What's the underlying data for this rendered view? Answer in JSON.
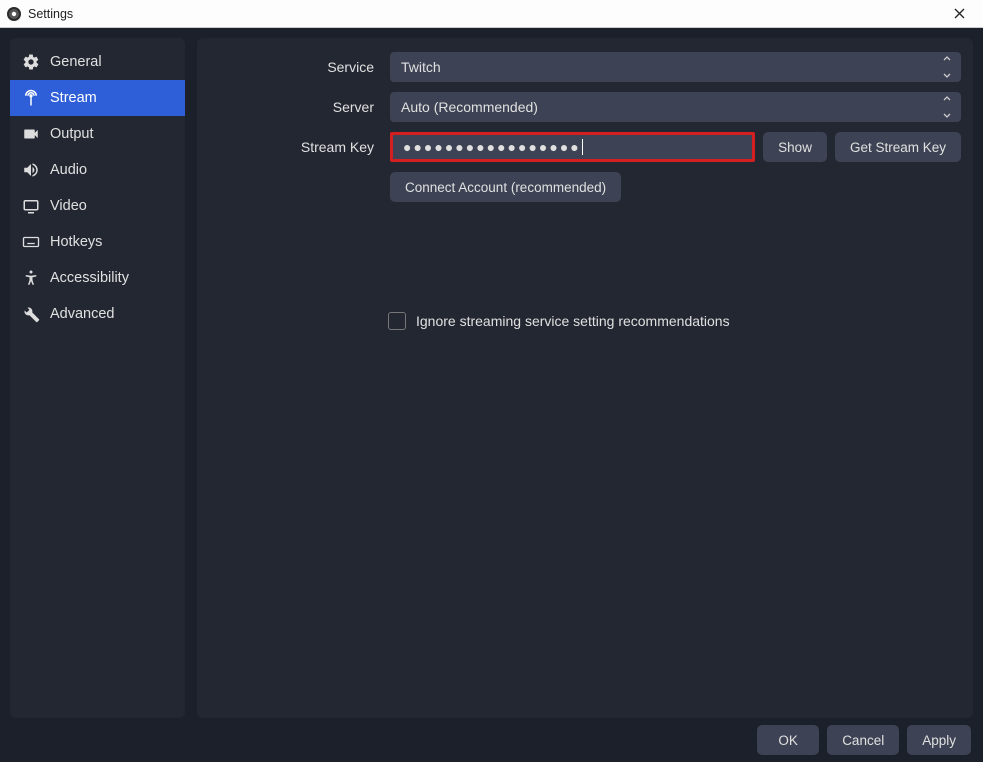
{
  "window": {
    "title": "Settings"
  },
  "sidebar": {
    "items": [
      {
        "label": "General",
        "icon": "gear-icon"
      },
      {
        "label": "Stream",
        "icon": "antenna-icon"
      },
      {
        "label": "Output",
        "icon": "camera-icon"
      },
      {
        "label": "Audio",
        "icon": "speaker-icon"
      },
      {
        "label": "Video",
        "icon": "monitor-icon"
      },
      {
        "label": "Hotkeys",
        "icon": "keyboard-icon"
      },
      {
        "label": "Accessibility",
        "icon": "accessibility-icon"
      },
      {
        "label": "Advanced",
        "icon": "tools-icon"
      }
    ],
    "active_index": 1
  },
  "form": {
    "service_label": "Service",
    "service_value": "Twitch",
    "server_label": "Server",
    "server_value": "Auto (Recommended)",
    "streamkey_label": "Stream Key",
    "streamkey_value": "●●●●●●●●●●●●●●●●●",
    "show_btn": "Show",
    "getkey_btn": "Get Stream Key",
    "connect_btn": "Connect Account (recommended)",
    "ignore_label": "Ignore streaming service setting recommendations"
  },
  "footer": {
    "ok": "OK",
    "cancel": "Cancel",
    "apply": "Apply"
  }
}
